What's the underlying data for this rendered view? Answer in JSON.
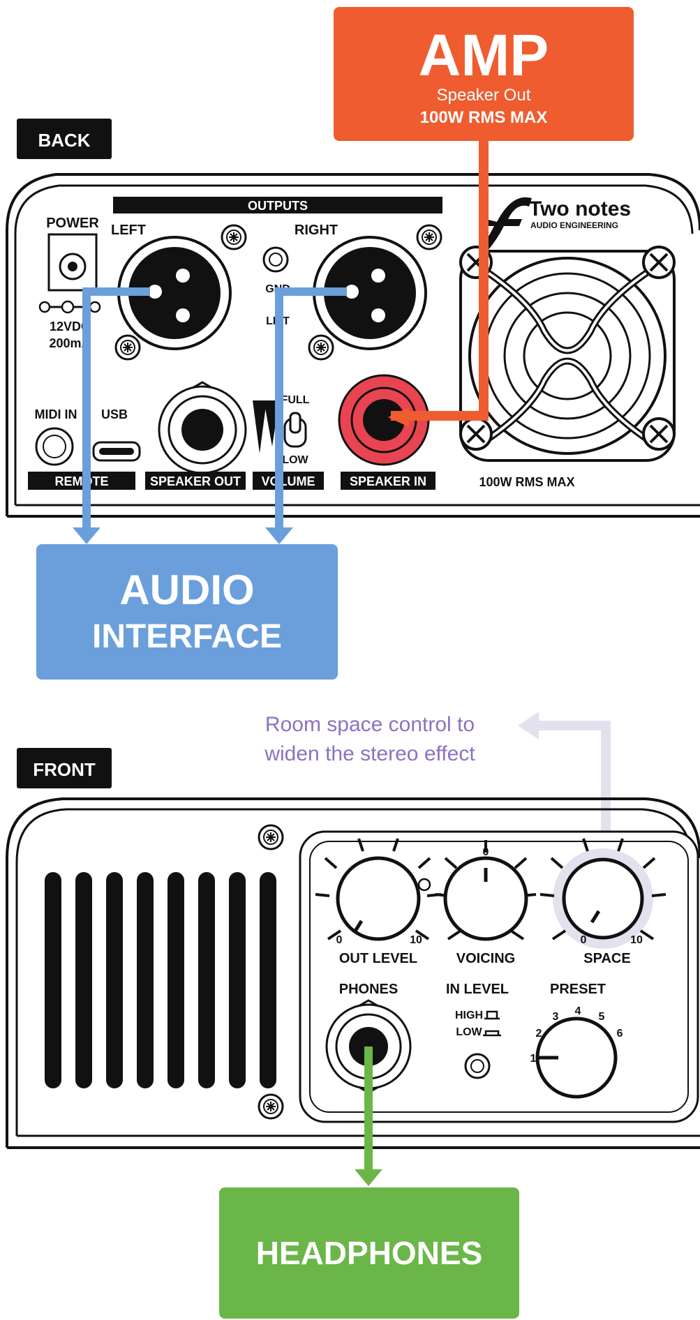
{
  "colors": {
    "amp": "#ef5c2f",
    "audio_interface": "#6a9fdb",
    "headphones": "#6bb649",
    "annotation_text": "#8b72c1",
    "annotation_arrow": "#e4e0ee",
    "panel_stroke": "#111111",
    "speaker_in_jack": "#e94451"
  },
  "amp": {
    "title": "AMP",
    "subtitle": "Speaker Out",
    "rating": "100W RMS MAX"
  },
  "back_label": "BACK",
  "front_label": "FRONT",
  "back_panel": {
    "brand": "Two notes",
    "brand_sub": "AUDIO ENGINEERING",
    "power": "POWER",
    "power_spec_1": "12VDC",
    "power_spec_2": "200mA",
    "outputs": "OUTPUTS",
    "left": "LEFT",
    "right": "RIGHT",
    "gnd": "GND",
    "lift": "LIFT",
    "midi_in": "MIDI IN",
    "usb": "USB",
    "full": "FULL",
    "low": "LOW",
    "remote": "REMOTE",
    "speaker_out": "SPEAKER OUT",
    "volume": "VOLUME",
    "speaker_in": "SPEAKER IN",
    "rms_max": "100W RMS MAX"
  },
  "audio_interface": {
    "line1": "AUDIO",
    "line2": "INTERFACE"
  },
  "annotation": {
    "line1": "Room space control to",
    "line2": "widen the stereo effect"
  },
  "front_panel": {
    "out_level": "OUT LEVEL",
    "voicing": "VOICING",
    "space": "SPACE",
    "phones": "PHONES",
    "in_level": "IN LEVEL",
    "preset": "PRESET",
    "high": "HIGH",
    "low": "LOW",
    "scale_min": "0",
    "scale_max": "10",
    "voicing_zero": "0",
    "preset_1": "1",
    "preset_2": "2",
    "preset_3": "3",
    "preset_4": "4",
    "preset_5": "5",
    "preset_6": "6"
  },
  "headphones": {
    "label": "HEADPHONES"
  }
}
